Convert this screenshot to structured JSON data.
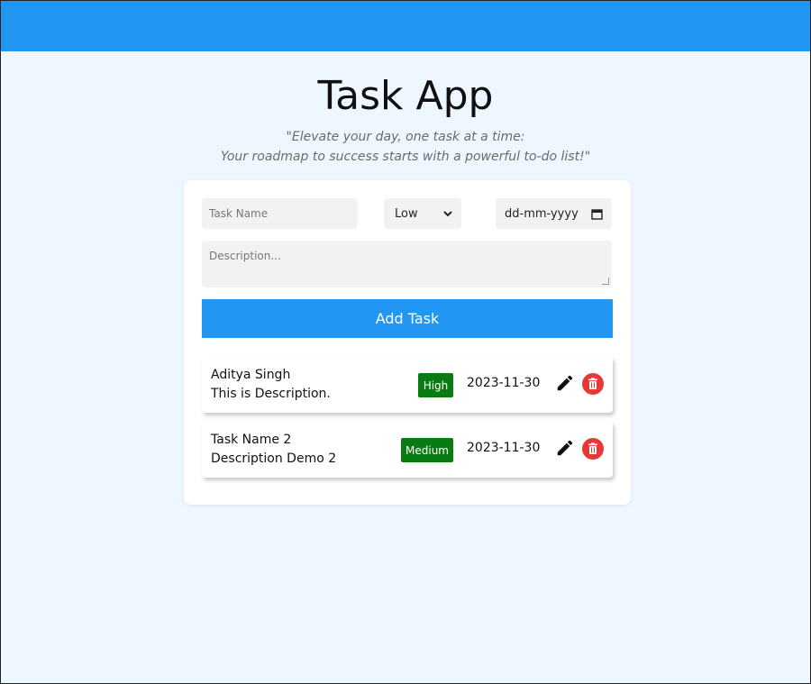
{
  "header": {
    "title": "Task App",
    "quote_line1": "\"Elevate your day, one task at a time:",
    "quote_line2": "Your roadmap to success starts with a powerful to-do list!\""
  },
  "form": {
    "task_name_placeholder": "Task Name",
    "priority_value": "Low",
    "date_placeholder": "dd-mm-yyyy",
    "description_placeholder": "Description...",
    "add_button_label": "Add Task"
  },
  "tasks": [
    {
      "name": "Aditya Singh",
      "description": "This is Description.",
      "priority": "High",
      "due": "2023-11-30"
    },
    {
      "name": "Task Name 2",
      "description": "Description Demo 2",
      "priority": "Medium",
      "due": "2023-11-30"
    }
  ],
  "colors": {
    "accent": "#2196f3",
    "priority_badge": "#0a7a12",
    "delete": "#e53935",
    "background": "#eef6ff"
  },
  "icons": {
    "edit": "pencil-icon",
    "delete": "trash-icon",
    "select_arrow": "chevron-down-icon",
    "calendar": "calendar-icon"
  }
}
